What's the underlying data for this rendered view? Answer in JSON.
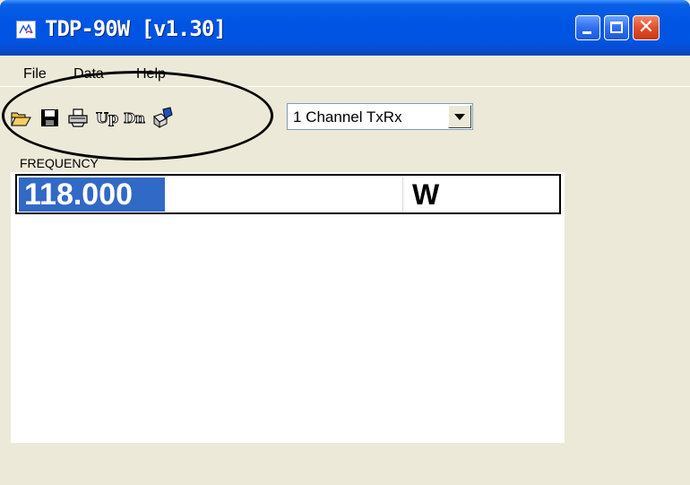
{
  "window": {
    "title": "TDP-90W [v1.30]"
  },
  "menu": [
    "File",
    "Data",
    "Help"
  ],
  "toolbar": {
    "tools": [
      {
        "icon": "open-folder-icon"
      },
      {
        "icon": "save-disk-icon"
      },
      {
        "icon": "print-icon"
      },
      {
        "icon": "upload-icon",
        "label": "Up"
      },
      {
        "icon": "download-icon",
        "label": "Dn"
      },
      {
        "icon": "connect-icon"
      }
    ],
    "channel_select": "1 Channel TxRx"
  },
  "main": {
    "frequency_label": "FREQUENCY",
    "frequency_value": "118.000",
    "unit": "W"
  },
  "colors": {
    "titlebar": "#0054e3",
    "selection": "#3169c6",
    "chrome": "#ece9d8"
  }
}
